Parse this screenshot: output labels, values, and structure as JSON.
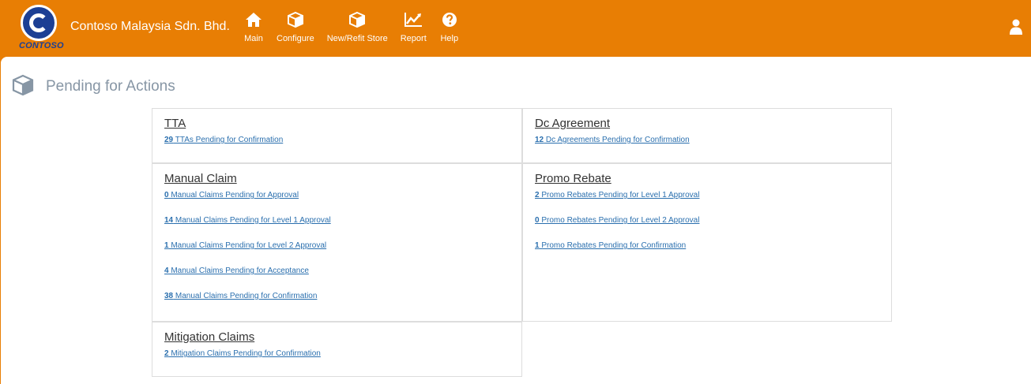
{
  "header": {
    "logo_text": "CONTOSO",
    "company": "Contoso Malaysia Sdn. Bhd.",
    "nav": [
      {
        "label": "Main",
        "icon": "home-icon"
      },
      {
        "label": "Configure",
        "icon": "cube-icon"
      },
      {
        "label": "New/Refit Store",
        "icon": "cube-icon"
      },
      {
        "label": "Report",
        "icon": "line-chart-icon"
      },
      {
        "label": "Help",
        "icon": "help-icon"
      }
    ],
    "user_icon": "user-icon",
    "accent": "#e87e04",
    "brand_blue": "#1c3f94"
  },
  "page": {
    "title": "Pending for Actions",
    "icon": "cube-icon",
    "title_color": "#8796a5",
    "link_color": "#2a6fae"
  },
  "cards": {
    "tta": {
      "title": "TTA",
      "links": [
        {
          "count": "29",
          "text": " TTAs Pending for Confirmation"
        }
      ]
    },
    "dc": {
      "title": "Dc Agreement",
      "links": [
        {
          "count": "12",
          "text": " Dc Agreements Pending for Confirmation"
        }
      ]
    },
    "manual": {
      "title": "Manual Claim",
      "links": [
        {
          "count": "0",
          "text": " Manual Claims Pending for Approval"
        },
        {
          "count": "14",
          "text": " Manual Claims Pending for Level 1 Approval"
        },
        {
          "count": "1",
          "text": " Manual Claims Pending for Level 2 Approval"
        },
        {
          "count": "4",
          "text": " Manual Claims Pending for Acceptance"
        },
        {
          "count": "38",
          "text": " Manual Claims Pending for Confirmation"
        }
      ]
    },
    "promo": {
      "title": "Promo Rebate",
      "links": [
        {
          "count": "2",
          "text": " Promo Rebates Pending for Level 1 Approval"
        },
        {
          "count": "0",
          "text": " Promo Rebates Pending for Level 2 Approval"
        },
        {
          "count": "1",
          "text": " Promo Rebates Pending for Confirmation"
        }
      ]
    },
    "mitigation": {
      "title": "Mitigation Claims",
      "links": [
        {
          "count": "2",
          "text": " Mitigation Claims Pending for Confirmation"
        }
      ]
    }
  }
}
